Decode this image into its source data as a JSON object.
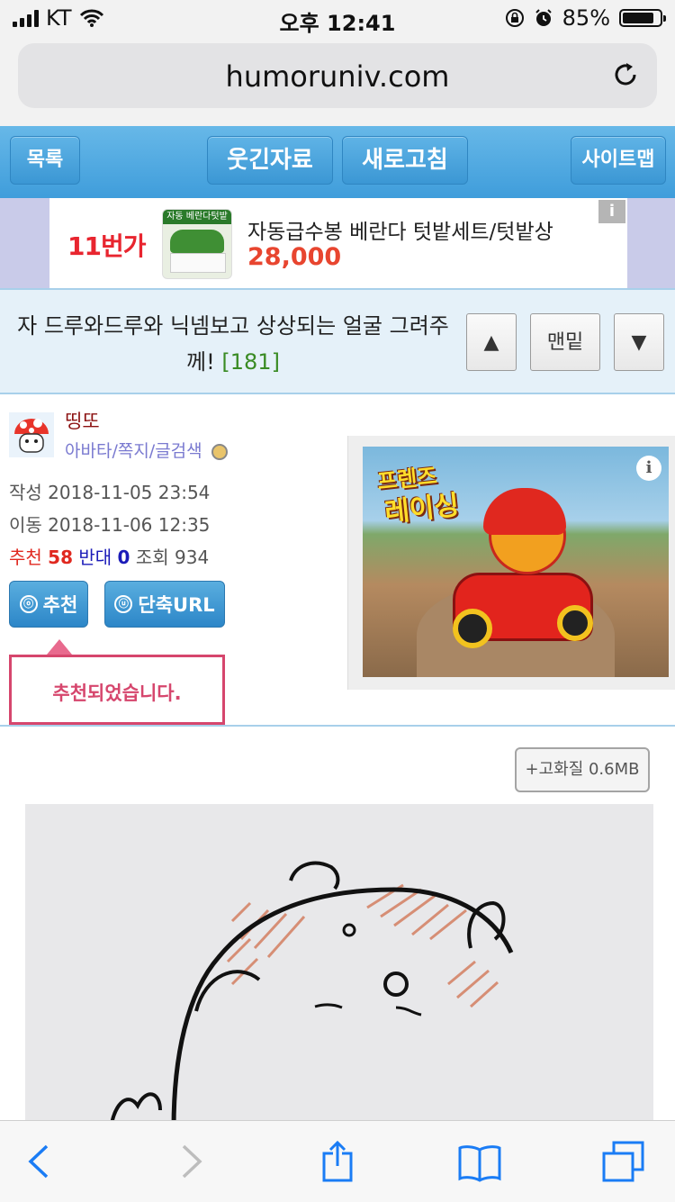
{
  "status": {
    "carrier": "KT",
    "time": "오후 12:41",
    "battery": "85%"
  },
  "browser": {
    "url": "humoruniv.com"
  },
  "nav": {
    "list": "목록",
    "humor": "웃긴자료",
    "refresh": "새로고침",
    "sitemap": "사이트맵"
  },
  "ad": {
    "logo": "11번가",
    "thumb_label": "자동 베란다텃밭",
    "title": "자동급수봉 베란다 텃밭세트/텃밭상",
    "price": "28,000",
    "info": "i"
  },
  "post": {
    "title": "자 드루와드루와 닉넴보고 상상되는 얼굴 그려주께!",
    "comment_count": "[181]",
    "up": "▲",
    "bottom": "맨밑",
    "down": "▼"
  },
  "author": {
    "nickname": "띵또",
    "links": "아바타/쪽지/글검색",
    "written_label": "작성",
    "written": "2018-11-05 23:54",
    "moved_label": "이동",
    "moved": "2018-11-06 12:35",
    "rec_label": "추천",
    "rec": "58",
    "opp_label": "반대",
    "opp": "0",
    "views_label": "조회",
    "views": "934"
  },
  "actions": {
    "recommend": "추천",
    "recommend_icon": "ⓞ",
    "short_url": "단축URL",
    "short_url_icon": "ⓤ"
  },
  "tooltip": "추천되었습니다.",
  "gamead": {
    "line1": "프렌즈",
    "line2": "레이싱",
    "info": "i"
  },
  "image": {
    "hq_button": "+고화질 0.6MB"
  },
  "colors": {
    "nav_blue": "#3f9ddb",
    "accent_pink": "#d6466d",
    "rec_red": "#e0281f",
    "opp_blue": "#1a1ab8"
  }
}
